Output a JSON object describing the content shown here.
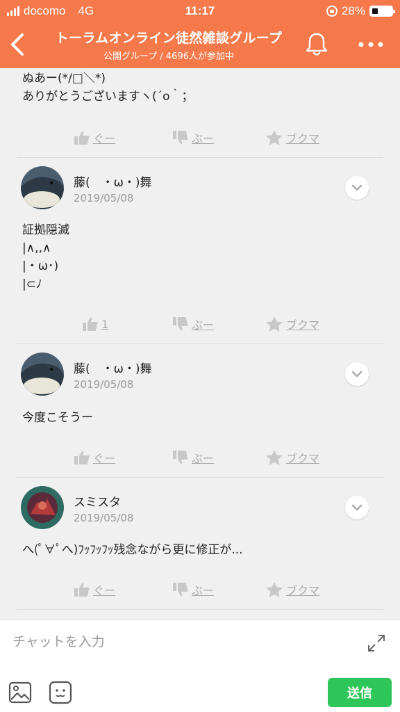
{
  "status_bar": {
    "carrier": "docomo",
    "network": "4G",
    "time": "11:17",
    "battery_text": "28%",
    "battery_level": 0.28
  },
  "header": {
    "title": "トーラムオンライン徒然雑談グループ",
    "subtitle": "公開グループ / 4696人が参加中"
  },
  "posts": [
    {
      "text": "ぬあー(*/□＼*)\nありがとうございますヽ(´o｀；",
      "reactions": {
        "good": "ぐー",
        "bad": "ぶー",
        "bookmark": "ブクマ"
      }
    },
    {
      "author": "藤(　・ω・)舞",
      "date": "2019/05/08",
      "text": "証拠隠滅\n|∧,,∧\n|・ω･)\n|⊂ﾉ",
      "reactions": {
        "good": "1",
        "bad": "ぶー",
        "bookmark": "ブクマ"
      }
    },
    {
      "author": "藤(　・ω・)舞",
      "date": "2019/05/08",
      "text": "今度こそうー",
      "reactions": {
        "good": "ぐー",
        "bad": "ぶー",
        "bookmark": "ブクマ"
      }
    },
    {
      "author": "スミスタ",
      "date": "2019/05/08",
      "text": "へ(ﾟ∀ﾟへ)ﾌｯﾌｯﾌｯ残念ながら更に修正が...",
      "reactions": {
        "good": "ぐー",
        "bad": "ぶー",
        "bookmark": "ブクマ"
      }
    }
  ],
  "composer": {
    "placeholder": "チャットを入力",
    "send_label": "送信"
  },
  "colors": {
    "brand": "#f5794a",
    "send": "#2ec658",
    "reaction": "#aaaaaa"
  },
  "icons": [
    "back-arrow-icon",
    "bell-icon",
    "more-icon",
    "thumbs-up-icon",
    "thumbs-down-icon",
    "star-icon",
    "chevron-down-icon",
    "expand-icon",
    "image-icon",
    "sticker-icon"
  ]
}
